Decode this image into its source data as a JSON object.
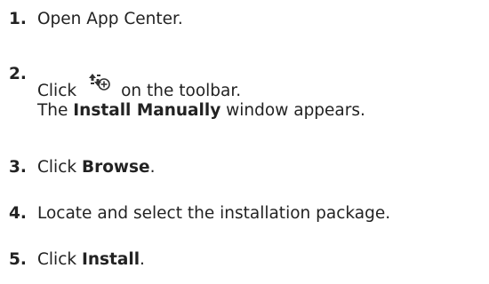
{
  "steps": [
    {
      "number": "1.",
      "text": "Open App Center."
    },
    {
      "number": "2.",
      "text_before": "Click",
      "icon": "install-manually-icon",
      "text_after": "on the toolbar.",
      "result_bold": "Install Manually",
      "result_rest": " window appears.",
      "result_prefix": "The "
    },
    {
      "number": "3.",
      "text": "Click ",
      "bold": "Browse",
      "suffix": "."
    },
    {
      "number": "4.",
      "text": "Locate and select the installation package."
    },
    {
      "number": "5.",
      "text": "Click ",
      "bold": "Install",
      "suffix": "."
    }
  ]
}
